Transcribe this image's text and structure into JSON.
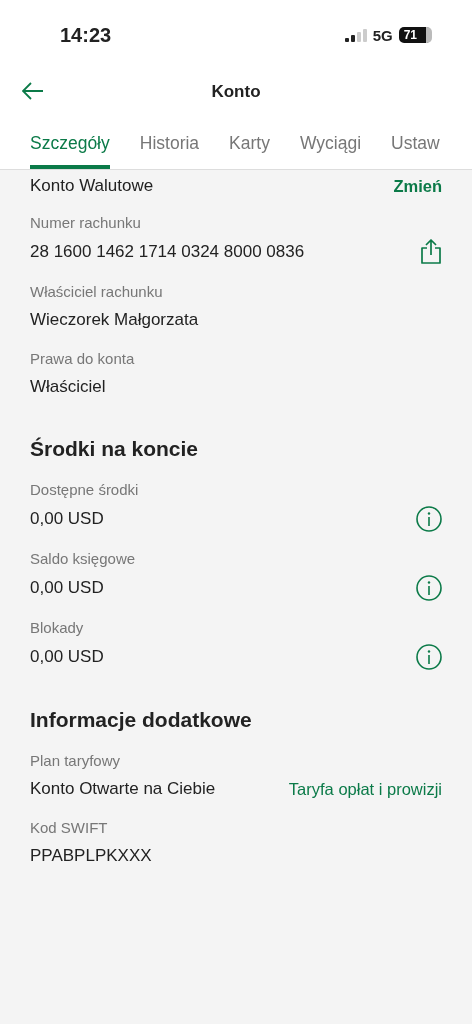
{
  "status_bar": {
    "time": "14:23",
    "network": "5G",
    "battery": "71"
  },
  "nav": {
    "title": "Konto"
  },
  "tabs": [
    {
      "label": "Szczegóły",
      "selected": true
    },
    {
      "label": "Historia",
      "selected": false
    },
    {
      "label": "Karty",
      "selected": false
    },
    {
      "label": "Wyciągi",
      "selected": false
    },
    {
      "label": "Ustaw",
      "selected": false
    }
  ],
  "account_type": {
    "name": "Konto Walutowe",
    "link": "Zmień"
  },
  "sections": [
    {
      "fields": [
        {
          "kind": "share",
          "label": "Numer rachunku",
          "value": "28 1600 1462 1714 0324 8000 0836"
        },
        {
          "kind": "plain",
          "label": "Właściciel rachunku",
          "value": "Wieczorek Małgorzata"
        },
        {
          "kind": "plain",
          "label": "Prawa do konta",
          "value": "Właściciel"
        }
      ]
    },
    {
      "heading": "Środki na koncie",
      "fields": [
        {
          "kind": "info",
          "label": "Dostępne środki",
          "value": "0,00 USD"
        },
        {
          "kind": "info",
          "label": "Saldo księgowe",
          "value": "0,00 USD"
        },
        {
          "kind": "info",
          "label": "Blokady",
          "value": "0,00 USD"
        }
      ]
    },
    {
      "heading": "Informacje dodatkowe",
      "fields": [
        {
          "kind": "link",
          "label": "Plan taryfowy",
          "value": "Konto Otwarte na Ciebie",
          "link": "Taryfa opłat i prowizji"
        },
        {
          "kind": "plain",
          "label": "Kod SWIFT",
          "value": "PPABPLPKXXX"
        }
      ]
    }
  ]
}
